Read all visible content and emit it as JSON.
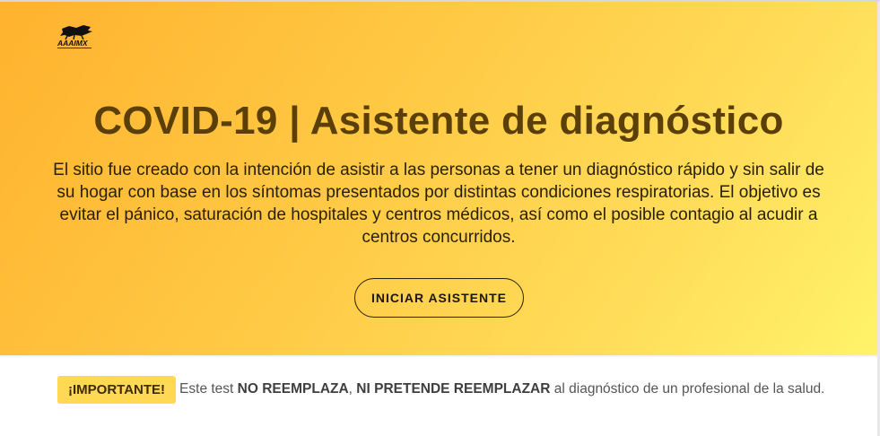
{
  "logo": {
    "text": "AAAIMX",
    "icon": "aaaimx-logo-icon"
  },
  "hero": {
    "title": "COVID-19 | Asistente de diagnóstico",
    "description": "El sitio fue creado con la intención de asistir a las personas a tener un diagnóstico rápido y sin salir de su hogar con base en los síntomas presentados por distintas condiciones respiratorias. El objetivo es evitar el pánico, saturación de hospitales y centros médicos, así como el posible contagio al acudir a centros concurridos.",
    "start_button": "INICIAR ASISTENTE"
  },
  "notice": {
    "badge": "¡IMPORTANTE!",
    "text_1": "Este test",
    "bold_1": "NO REEMPLAZA",
    "separator": ",",
    "bold_2": "NI PRETENDE REEMPLAZAR",
    "text_2": "al diagnóstico de un profesional de la salud."
  },
  "colors": {
    "hero_start": "#ffb22e",
    "hero_end": "#fff36a",
    "title": "#5b3f08",
    "badge_bg": "#ffd954"
  }
}
